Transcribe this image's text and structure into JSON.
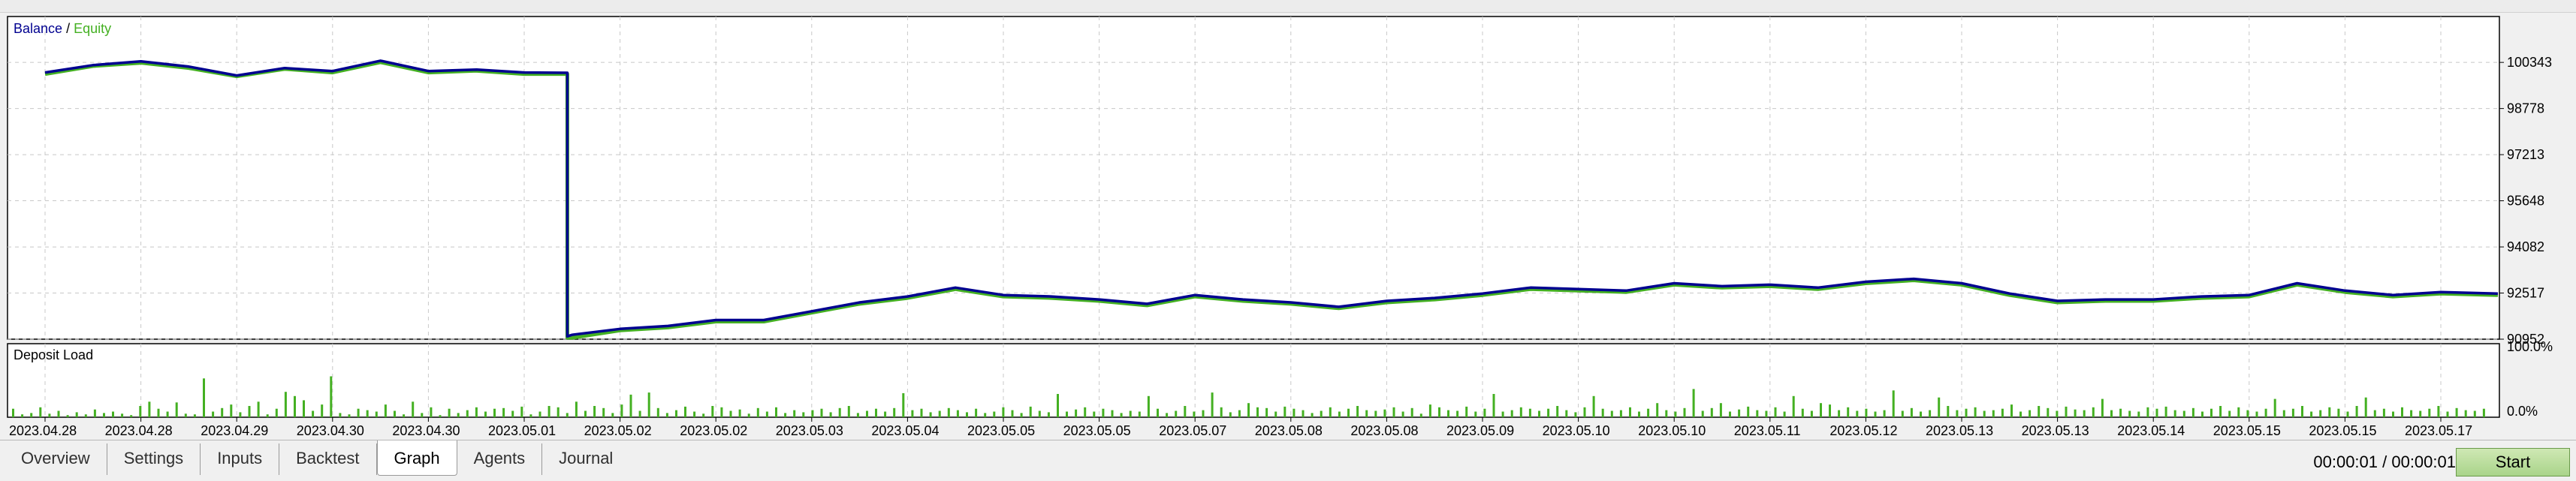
{
  "chart_data": [
    {
      "type": "line",
      "legend": {
        "balance_label": "Balance",
        "separator": " / ",
        "equity_label": "Equity",
        "placement": "top-left"
      },
      "ylim": [
        90952,
        101900
      ],
      "y_ticks": [
        "100343",
        "98778",
        "97213",
        "95648",
        "94082",
        "92517",
        "90952"
      ],
      "x_ticks": [
        "2023.04.28",
        "2023.04.28",
        "2023.04.29",
        "2023.04.30",
        "2023.04.30",
        "2023.05.01",
        "2023.05.02",
        "2023.05.02",
        "2023.05.03",
        "2023.05.04",
        "2023.05.05",
        "2023.05.05",
        "2023.05.07",
        "2023.05.08",
        "2023.05.08",
        "2023.05.09",
        "2023.05.10",
        "2023.05.10",
        "2023.05.11",
        "2023.05.12",
        "2023.05.13",
        "2023.05.13",
        "2023.05.14",
        "2023.05.15",
        "2023.05.15",
        "2023.05.17"
      ],
      "grid": true,
      "colors": {
        "balance": "#000090",
        "equity": "#44b022"
      },
      "series": [
        {
          "name": "Balance",
          "x_index": [
            0,
            0.5,
            1,
            1.5,
            2,
            2.5,
            3,
            3.5,
            4,
            4.5,
            5,
            5.45,
            5.45,
            5.5,
            6,
            6.5,
            7,
            7.5,
            8,
            8.5,
            9,
            9.5,
            10,
            10.5,
            11,
            11.5,
            12,
            12.5,
            13,
            13.5,
            14,
            14.5,
            15,
            15.5,
            16,
            16.5,
            17,
            17.5,
            18,
            18.5,
            19,
            19.5,
            20,
            20.5,
            21,
            21.5,
            22,
            22.5,
            23,
            23.5,
            24,
            24.5,
            25,
            25.6
          ],
          "values": [
            100000,
            100250,
            100380,
            100200,
            99900,
            100150,
            100050,
            100400,
            100050,
            100100,
            100000,
            99990,
            91050,
            91100,
            91300,
            91400,
            91600,
            91600,
            91900,
            92200,
            92400,
            92700,
            92450,
            92400,
            92300,
            92150,
            92450,
            92300,
            92200,
            92050,
            92250,
            92350,
            92500,
            92700,
            92650,
            92600,
            92850,
            92750,
            92800,
            92700,
            92900,
            93000,
            92850,
            92500,
            92250,
            92300,
            92300,
            92400,
            92450,
            92850,
            92600,
            92450,
            92550,
            92500
          ]
        },
        {
          "name": "Equity",
          "x_index": [
            0,
            0.5,
            1,
            1.5,
            2,
            2.5,
            3,
            3.5,
            4,
            4.5,
            5,
            5.45,
            5.45,
            5.5,
            6,
            6.5,
            7,
            7.5,
            8,
            8.5,
            9,
            9.5,
            10,
            10.5,
            11,
            11.5,
            12,
            12.5,
            13,
            13.5,
            14,
            14.5,
            15,
            15.5,
            16,
            16.5,
            17,
            17.5,
            18,
            18.5,
            19,
            19.5,
            20,
            20.5,
            21,
            21.5,
            22,
            22.5,
            23,
            23.5,
            24,
            24.5,
            25,
            25.6
          ],
          "values": [
            99950,
            100220,
            100330,
            100150,
            99870,
            100120,
            100000,
            100350,
            100000,
            100060,
            99950,
            99950,
            91000,
            91000,
            91250,
            91350,
            91550,
            91550,
            91850,
            92150,
            92350,
            92650,
            92400,
            92350,
            92250,
            92100,
            92400,
            92250,
            92150,
            92000,
            92200,
            92300,
            92450,
            92650,
            92600,
            92550,
            92800,
            92700,
            92750,
            92650,
            92850,
            92950,
            92800,
            92450,
            92200,
            92250,
            92250,
            92350,
            92400,
            92800,
            92550,
            92400,
            92500,
            92450
          ]
        }
      ]
    },
    {
      "type": "bar",
      "title": "Deposit Load",
      "y_ticks": [
        "100.0%",
        "0.0%"
      ],
      "ylim": [
        0,
        100
      ],
      "color": "#44b022",
      "values": [
        12,
        4,
        6,
        14,
        5,
        9,
        3,
        7,
        4,
        11,
        6,
        8,
        5,
        3,
        16,
        22,
        12,
        8,
        21,
        5,
        4,
        55,
        8,
        13,
        18,
        7,
        16,
        22,
        4,
        12,
        36,
        30,
        24,
        9,
        18,
        58,
        6,
        4,
        12,
        10,
        8,
        18,
        9,
        4,
        22,
        6,
        14,
        3,
        12,
        6,
        10,
        14,
        8,
        12,
        13,
        9,
        15,
        4,
        8,
        16,
        14,
        6,
        22,
        9,
        16,
        13,
        6,
        18,
        32,
        9,
        35,
        13,
        6,
        10,
        15,
        8,
        5,
        16,
        14,
        9,
        11,
        5,
        13,
        8,
        14,
        6,
        10,
        7,
        10,
        12,
        7,
        13,
        16,
        6,
        9,
        12,
        8,
        13,
        34,
        10,
        12,
        7,
        9,
        13,
        10,
        7,
        12,
        6,
        8,
        14,
        10,
        6,
        15,
        9,
        7,
        33,
        8,
        11,
        14,
        8,
        12,
        10,
        6,
        9,
        8,
        30,
        12,
        6,
        9,
        16,
        8,
        10,
        35,
        14,
        7,
        10,
        20,
        14,
        13,
        8,
        15,
        12,
        10,
        6,
        9,
        14,
        8,
        12,
        16,
        10,
        9,
        11,
        14,
        8,
        13,
        5,
        18,
        14,
        10,
        9,
        15,
        8,
        12,
        33,
        8,
        10,
        14,
        12,
        9,
        12,
        16,
        10,
        7,
        14,
        30,
        12,
        9,
        10,
        14,
        8,
        12,
        20,
        10,
        8,
        13,
        40,
        9,
        13,
        20,
        8,
        11,
        15,
        10,
        9,
        14,
        8,
        30,
        12,
        9,
        20,
        18,
        10,
        14,
        9,
        12,
        8,
        10,
        38,
        9,
        13,
        8,
        10,
        28,
        16,
        10,
        12,
        14,
        9,
        10,
        12,
        18,
        8,
        10,
        16,
        13,
        9,
        15,
        11,
        10,
        14,
        26,
        10,
        12,
        9,
        8,
        14,
        12,
        15,
        10,
        9,
        13,
        8,
        12,
        16,
        9,
        14,
        10,
        8,
        12,
        26,
        10,
        12,
        16,
        8,
        10,
        14,
        12,
        8,
        16,
        28,
        10,
        12,
        8,
        14,
        10,
        9,
        12,
        16,
        8,
        13,
        10,
        9,
        12
      ]
    }
  ],
  "tabs": [
    "Overview",
    "Settings",
    "Inputs",
    "Backtest",
    "Graph",
    "Agents",
    "Journal"
  ],
  "active_tab": "Graph",
  "timer": "00:00:01 / 00:00:01",
  "start_label": "Start"
}
